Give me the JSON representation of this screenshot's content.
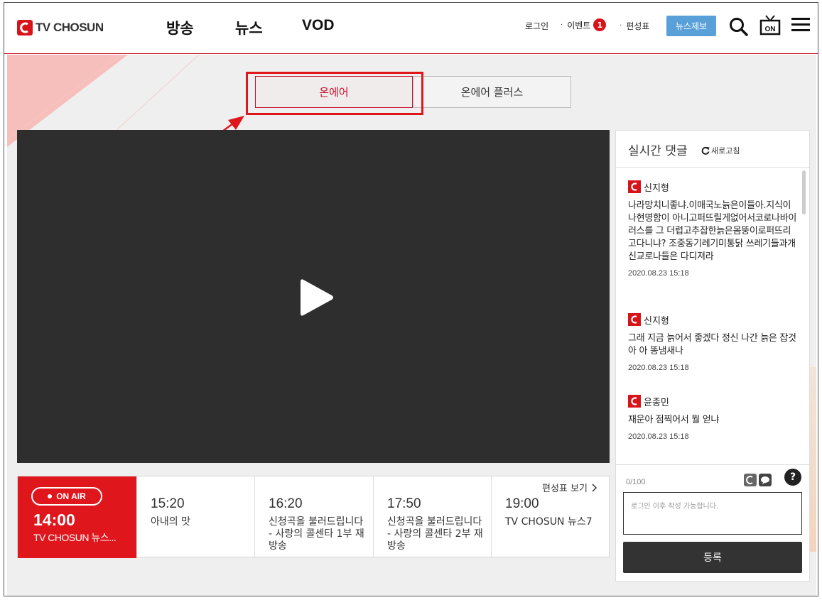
{
  "header": {
    "logo_text": "TV CHOSUN",
    "nav": [
      "방송",
      "뉴스",
      "VOD"
    ],
    "login": "로그인",
    "event": "이벤트",
    "event_badge": "1",
    "schedule": "편성표",
    "tip_button": "뉴스제보",
    "icons": [
      "search-icon",
      "tv-on-icon",
      "menu-icon"
    ],
    "accent": "#d7141a"
  },
  "tabs": [
    {
      "label": "온에어",
      "active": true
    },
    {
      "label": "온에어 플러스",
      "active": false
    }
  ],
  "player": {
    "icon": "play-icon"
  },
  "schedule": {
    "link": "편성표 보기",
    "onair_badge": "ON AIR",
    "current": {
      "time": "14:00",
      "title": "TV CHOSUN 뉴스..."
    },
    "slots": [
      {
        "time": "15:20",
        "title": "아내의 맛"
      },
      {
        "time": "16:20",
        "title": "신청곡을 불러드립니다 - 사랑의 콜센타 1부 재방송"
      },
      {
        "time": "17:50",
        "title": "신청곡을 불러드립니다 - 사랑의 콜센타 2부 재방송"
      },
      {
        "time": "19:00",
        "title": "TV CHOSUN 뉴스7"
      }
    ]
  },
  "comments": {
    "title": "실시간 댓글",
    "refresh": "새로고침",
    "items": [
      {
        "author": "신지형",
        "text": "나라망치니좋냐.이매국노늙은이들아.지식이나현명함이 아니고퍼뜨릴게없어서코로나바이러스를 그 더럽고추잡한늙은몸뚱이로퍼뜨리고다니냐? 조중동기레기미통닭 쓰레기들과개신교로나들은 다디져라",
        "date": "2020.08.23 15:18"
      },
      {
        "author": "신지형",
        "text": "그래 지금 늙어서 좋겠다 정신 나간 늙은 잡것아 아 똥냄새나",
        "date": "2020.08.23 15:18"
      },
      {
        "author": "윤종민",
        "text": "재운아 점찍어서 뭘 얻냐",
        "date": "2020.08.23 15:18"
      }
    ],
    "count": "0/100",
    "placeholder": "로그인 이후 작성 가능합니다.",
    "submit": "등록",
    "help": "?"
  }
}
